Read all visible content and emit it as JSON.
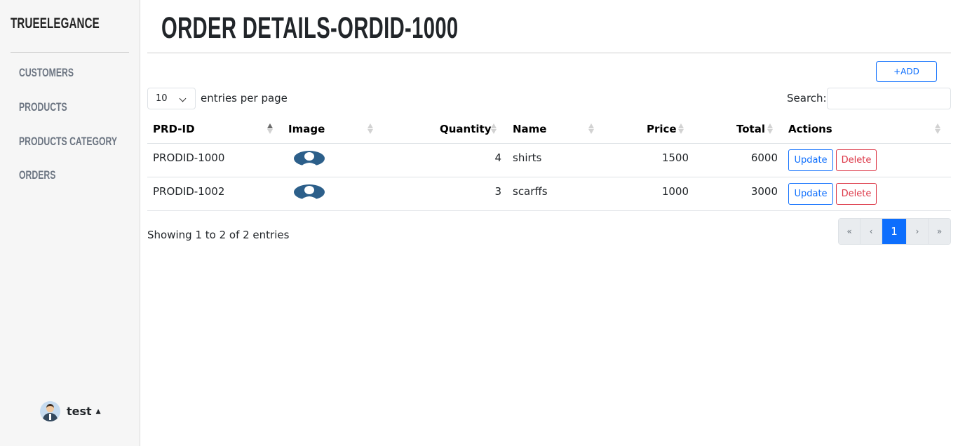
{
  "sidebar": {
    "brand": "TRUEELEGANCE",
    "items": [
      {
        "label": "CUSTOMERS"
      },
      {
        "label": "PRODUCTS"
      },
      {
        "label": "PRODUCTS CATEGORY"
      },
      {
        "label": "ORDERS"
      }
    ],
    "user": {
      "name": "test",
      "caret": "▲"
    }
  },
  "header": {
    "title": "ORDER DETAILS-ORDID-1000"
  },
  "toolbar": {
    "add_label": "+ADD"
  },
  "table_controls": {
    "entries_value": "10",
    "entries_label": "entries per page",
    "search_label": "Search:",
    "search_value": ""
  },
  "table": {
    "columns": [
      "PRD-ID",
      "Image",
      "Quantity",
      "Name",
      "Price",
      "Total",
      "Actions"
    ],
    "sorted_column": "PRD-ID",
    "image_icon": "user-silhouette-icon",
    "rows": [
      {
        "prd_id": "PRODID-1000",
        "quantity": "4",
        "name": "shirts",
        "price": "1500",
        "total": "6000",
        "update": "Update",
        "delete": "Delete"
      },
      {
        "prd_id": "PRODID-1002",
        "quantity": "3",
        "name": "scarffs",
        "price": "1000",
        "total": "3000",
        "update": "Update",
        "delete": "Delete"
      }
    ]
  },
  "footer": {
    "info": "Showing 1 to 2 of 2 entries",
    "pagination": [
      "«",
      "‹",
      "1",
      "›",
      "»"
    ],
    "current_page": "1"
  },
  "colors": {
    "accent": "#0d6efd",
    "danger": "#dc3545",
    "sidebar_bg": "#f6f6f6",
    "image_icon": "#2c5f8a"
  }
}
